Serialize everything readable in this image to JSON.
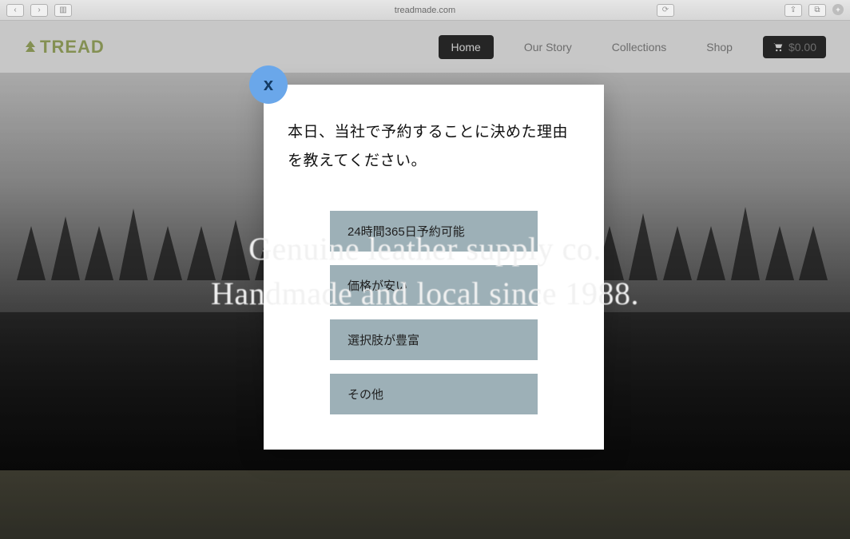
{
  "browser": {
    "address": "treadmade.com",
    "reload_glyph": "⟳",
    "back_glyph": "‹",
    "fwd_glyph": "›",
    "sidebar_glyph": "▥",
    "share_glyph": "⇪",
    "tabs_glyph": "⧉",
    "plus_glyph": "+"
  },
  "header": {
    "logo_text": "TREAD",
    "nav": {
      "home": "Home",
      "our_story": "Our Story",
      "collections": "Collections",
      "shop": "Shop"
    },
    "cart_amount": "$0.00"
  },
  "hero": {
    "line1": "Genuine leather supply co.",
    "line2": "Handmade and local since 1988."
  },
  "modal": {
    "close_label": "x",
    "question": "本日、当社で予約することに決めた理由を教えてください。",
    "options": [
      "24時間365日予約可能",
      "価格が安い",
      "選択肢が豊富",
      "その他"
    ]
  }
}
